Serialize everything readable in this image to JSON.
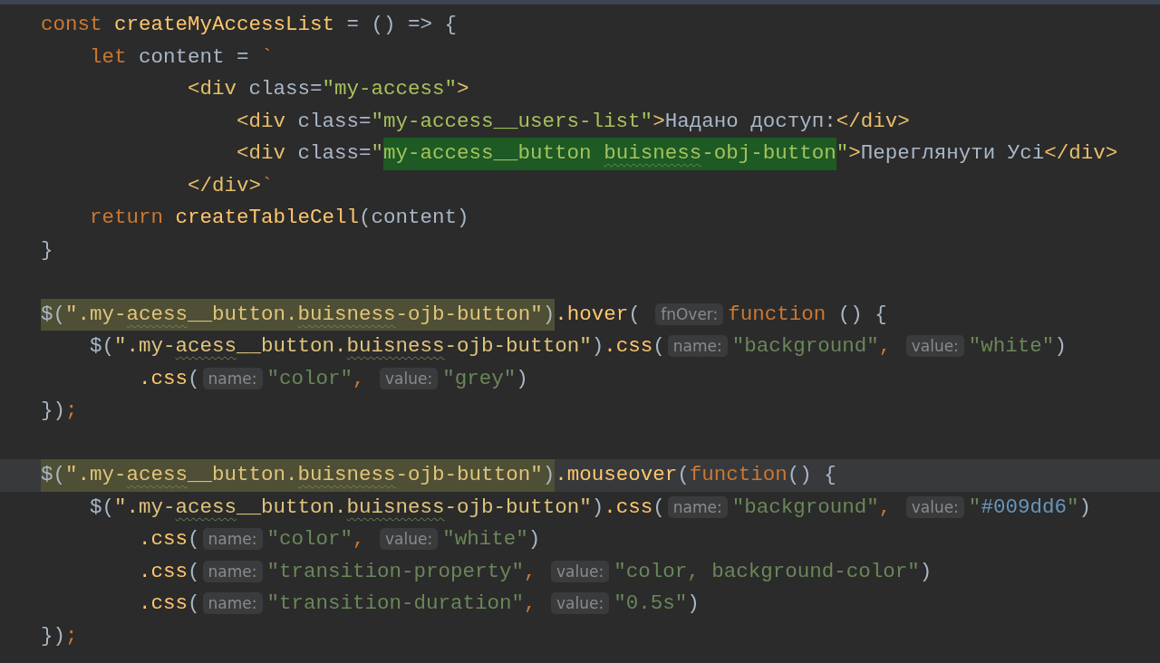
{
  "editor": {
    "lines": [
      {
        "current": false,
        "tokens": [
          {
            "kind": "keyword",
            "text": "const "
          },
          {
            "kind": "function",
            "text": "createMyAccessList"
          },
          {
            "kind": "plain",
            "text": " = () => {"
          }
        ]
      },
      {
        "current": false,
        "tokens": [
          {
            "kind": "keyword",
            "text": "    let "
          },
          {
            "kind": "plain",
            "text": "content = "
          },
          {
            "kind": "keyword",
            "text": "`"
          }
        ]
      },
      {
        "current": false,
        "tokens": [
          {
            "kind": "tag",
            "text": "            <div "
          },
          {
            "kind": "plain",
            "text": "class="
          },
          {
            "kind": "template_string",
            "text": "\"my-access\""
          },
          {
            "kind": "tag",
            "text": ">"
          }
        ]
      },
      {
        "current": false,
        "tokens": [
          {
            "kind": "tag",
            "text": "                <div "
          },
          {
            "kind": "plain",
            "text": "class="
          },
          {
            "kind": "template_string",
            "text": "\"my-access__users-list\""
          },
          {
            "kind": "tag",
            "text": ">"
          },
          {
            "kind": "plain",
            "text": "Надано доступ:"
          },
          {
            "kind": "tag",
            "text": "</div>"
          }
        ]
      },
      {
        "current": false,
        "tokens": [
          {
            "kind": "tag",
            "text": "                <div "
          },
          {
            "kind": "plain",
            "text": "class="
          },
          {
            "kind": "template_string",
            "text": "\""
          },
          {
            "kind": "match",
            "tokens": [
              {
                "kind": "template_string",
                "text": "my-access__button "
              },
              {
                "kind": "template_string_typo",
                "text": "buisness"
              },
              {
                "kind": "template_string",
                "text": "-obj-button"
              }
            ]
          },
          {
            "kind": "template_string",
            "text": "\""
          },
          {
            "kind": "tag",
            "text": ">"
          },
          {
            "kind": "plain",
            "text": "Переглянути Усі"
          },
          {
            "kind": "tag",
            "text": "</div>"
          }
        ]
      },
      {
        "current": false,
        "tokens": [
          {
            "kind": "tag",
            "text": "            </div>"
          },
          {
            "kind": "keyword",
            "text": "`"
          }
        ]
      },
      {
        "current": false,
        "tokens": [
          {
            "kind": "keyword",
            "text": "    return "
          },
          {
            "kind": "function",
            "text": "createTableCell"
          },
          {
            "kind": "plain",
            "text": "(content)"
          }
        ]
      },
      {
        "current": false,
        "tokens": [
          {
            "kind": "plain",
            "text": "}"
          }
        ]
      },
      {
        "current": false
      },
      {
        "current": false,
        "tokens": [
          {
            "kind": "selection",
            "tokens": [
              {
                "kind": "plain",
                "text": "$("
              },
              {
                "kind": "selector",
                "text": "\".my-"
              },
              {
                "kind": "selector_typo",
                "text": "acess"
              },
              {
                "kind": "selector",
                "text": "__button."
              },
              {
                "kind": "selector_typo",
                "text": "buisness"
              },
              {
                "kind": "selector",
                "text": "-ojb-button\""
              },
              {
                "kind": "plain",
                "text": ")"
              }
            ]
          },
          {
            "kind": "function",
            "text": ".hover"
          },
          {
            "kind": "plain",
            "text": "( "
          },
          {
            "kind": "hint",
            "text": "fnOver:"
          },
          {
            "kind": "keyword",
            "text": "function"
          },
          {
            "kind": "plain",
            "text": " () {"
          }
        ]
      },
      {
        "current": false,
        "tokens": [
          {
            "kind": "plain",
            "text": "    $("
          },
          {
            "kind": "selector",
            "text": "\".my-"
          },
          {
            "kind": "selector_typo",
            "text": "acess"
          },
          {
            "kind": "selector",
            "text": "__button."
          },
          {
            "kind": "selector_typo",
            "text": "buisness"
          },
          {
            "kind": "selector",
            "text": "-ojb-button\""
          },
          {
            "kind": "plain",
            "text": ")"
          },
          {
            "kind": "function",
            "text": ".css"
          },
          {
            "kind": "plain",
            "text": "("
          },
          {
            "kind": "hint",
            "text": "name:"
          },
          {
            "kind": "string",
            "text": "\"background\""
          },
          {
            "kind": "keyword",
            "text": ", "
          },
          {
            "kind": "hint",
            "text": "value:"
          },
          {
            "kind": "string",
            "text": "\"white\""
          },
          {
            "kind": "plain",
            "text": ")"
          }
        ]
      },
      {
        "current": false,
        "tokens": [
          {
            "kind": "function",
            "text": "        .css"
          },
          {
            "kind": "plain",
            "text": "("
          },
          {
            "kind": "hint",
            "text": "name:"
          },
          {
            "kind": "string",
            "text": "\"color\""
          },
          {
            "kind": "keyword",
            "text": ", "
          },
          {
            "kind": "hint",
            "text": "value:"
          },
          {
            "kind": "string",
            "text": "\"grey\""
          },
          {
            "kind": "plain",
            "text": ")"
          }
        ]
      },
      {
        "current": false,
        "tokens": [
          {
            "kind": "plain",
            "text": "})"
          },
          {
            "kind": "keyword",
            "text": ";"
          }
        ]
      },
      {
        "current": false
      },
      {
        "current": true,
        "tokens": [
          {
            "kind": "selection",
            "tokens": [
              {
                "kind": "plain",
                "text": "$("
              },
              {
                "kind": "selector",
                "text": "\".my-"
              },
              {
                "kind": "selector_typo",
                "text": "acess"
              },
              {
                "kind": "selector",
                "text": "__button."
              },
              {
                "kind": "selector_typo",
                "text": "buisness"
              },
              {
                "kind": "selector",
                "text": "-ojb-button\""
              },
              {
                "kind": "plain",
                "text": ")"
              }
            ]
          },
          {
            "kind": "function",
            "text": ".mouseover"
          },
          {
            "kind": "plain",
            "text": "("
          },
          {
            "kind": "keyword",
            "text": "function"
          },
          {
            "kind": "plain",
            "text": "() {"
          }
        ]
      },
      {
        "current": false,
        "tokens": [
          {
            "kind": "plain",
            "text": "    $("
          },
          {
            "kind": "selector",
            "text": "\".my-"
          },
          {
            "kind": "selector_typo",
            "text": "acess"
          },
          {
            "kind": "selector",
            "text": "__button."
          },
          {
            "kind": "selector_typo",
            "text": "buisness"
          },
          {
            "kind": "selector",
            "text": "-ojb-button\""
          },
          {
            "kind": "plain",
            "text": ")"
          },
          {
            "kind": "function",
            "text": ".css"
          },
          {
            "kind": "plain",
            "text": "("
          },
          {
            "kind": "hint",
            "text": "name:"
          },
          {
            "kind": "string",
            "text": "\"background\""
          },
          {
            "kind": "keyword",
            "text": ", "
          },
          {
            "kind": "hint",
            "text": "value:"
          },
          {
            "kind": "string",
            "text": "\""
          },
          {
            "kind": "number",
            "text": "#009dd6"
          },
          {
            "kind": "string",
            "text": "\""
          },
          {
            "kind": "plain",
            "text": ")"
          }
        ]
      },
      {
        "current": false,
        "tokens": [
          {
            "kind": "function",
            "text": "        .css"
          },
          {
            "kind": "plain",
            "text": "("
          },
          {
            "kind": "hint",
            "text": "name:"
          },
          {
            "kind": "string",
            "text": "\"color\""
          },
          {
            "kind": "keyword",
            "text": ", "
          },
          {
            "kind": "hint",
            "text": "value:"
          },
          {
            "kind": "string",
            "text": "\"white\""
          },
          {
            "kind": "plain",
            "text": ")"
          }
        ]
      },
      {
        "current": false,
        "tokens": [
          {
            "kind": "function",
            "text": "        .css"
          },
          {
            "kind": "plain",
            "text": "("
          },
          {
            "kind": "hint",
            "text": "name:"
          },
          {
            "kind": "string",
            "text": "\"transition-property\""
          },
          {
            "kind": "keyword",
            "text": ", "
          },
          {
            "kind": "hint",
            "text": "value:"
          },
          {
            "kind": "string",
            "text": "\"color, background-color\""
          },
          {
            "kind": "plain",
            "text": ")"
          }
        ]
      },
      {
        "current": false,
        "tokens": [
          {
            "kind": "function",
            "text": "        .css"
          },
          {
            "kind": "plain",
            "text": "("
          },
          {
            "kind": "hint",
            "text": "name:"
          },
          {
            "kind": "string",
            "text": "\"transition-duration\""
          },
          {
            "kind": "keyword",
            "text": ", "
          },
          {
            "kind": "hint",
            "text": "value:"
          },
          {
            "kind": "string",
            "text": "\"0.5s\""
          },
          {
            "kind": "plain",
            "text": ")"
          }
        ]
      },
      {
        "current": false,
        "tokens": [
          {
            "kind": "plain",
            "text": "})"
          },
          {
            "kind": "keyword",
            "text": ";"
          }
        ]
      }
    ]
  }
}
